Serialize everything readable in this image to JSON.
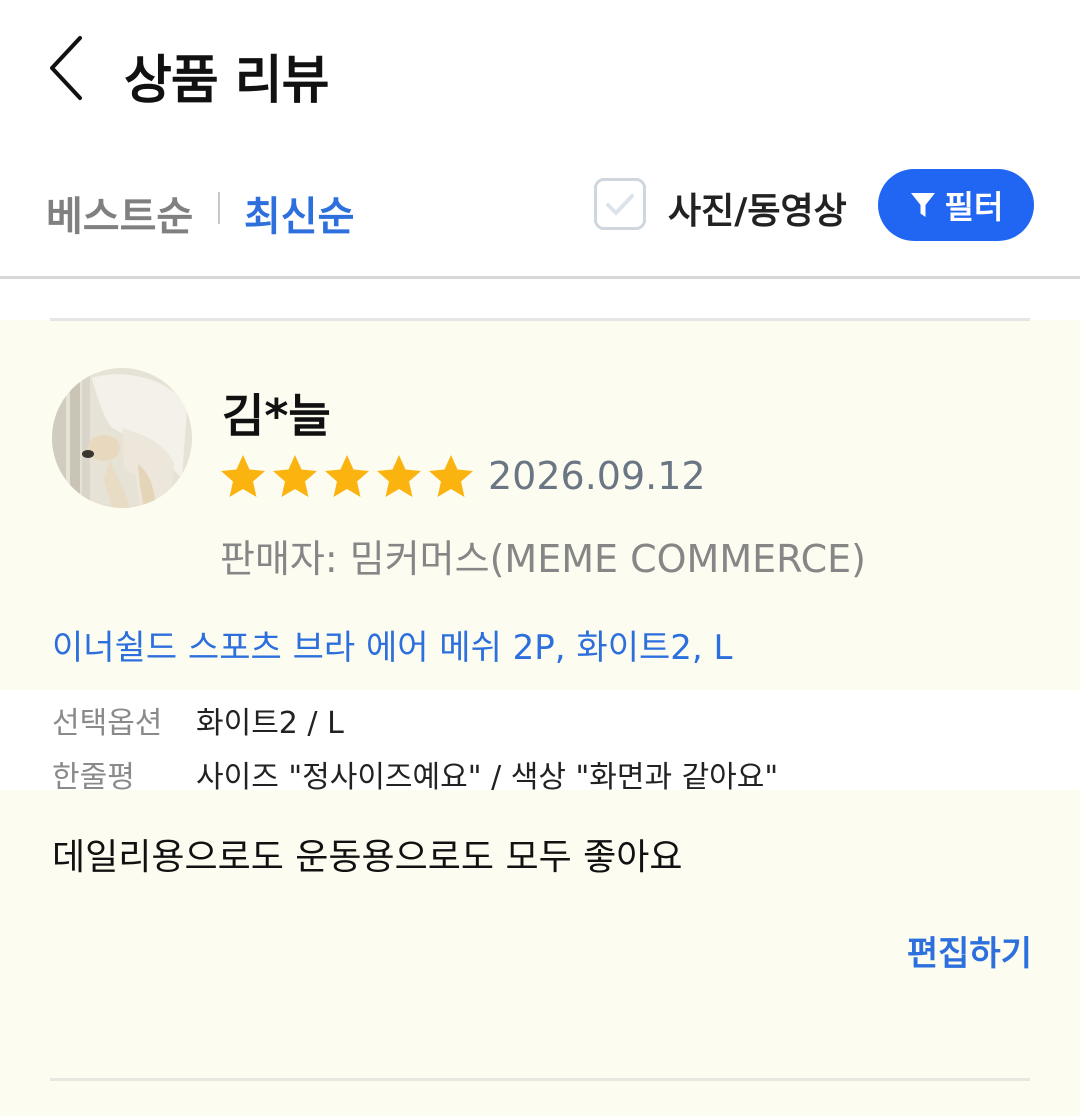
{
  "header": {
    "title": "상품 리뷰"
  },
  "sort": {
    "best_label": "베스트순",
    "latest_label": "최신순"
  },
  "filters": {
    "photo_video_label": "사진/동영상",
    "filter_label": "필터"
  },
  "review": {
    "reviewer": "김*늘",
    "rating": 5,
    "rating_max": 5,
    "date": "2026.09.12",
    "seller": "판매자: 밈커머스(MEME COMMERCE)",
    "product": "이너쉴드 스포츠 브라 에어 메쉬 2P, 화이트2, L",
    "options": [
      {
        "label": "선택옵션",
        "value": "화이트2 / L"
      },
      {
        "label": "한줄평",
        "value": "사이즈 \"정사이즈예요\" / 색상 \"화면과 같아요\""
      }
    ],
    "body": "데일리용으로도 운동용으로도 모두 좋아요",
    "edit_label": "편집하기"
  },
  "colors": {
    "accent": "#2c6fdd",
    "filter_button": "#2166f3",
    "star": "#fbb30f",
    "card_bg": "#fdfcf1"
  }
}
